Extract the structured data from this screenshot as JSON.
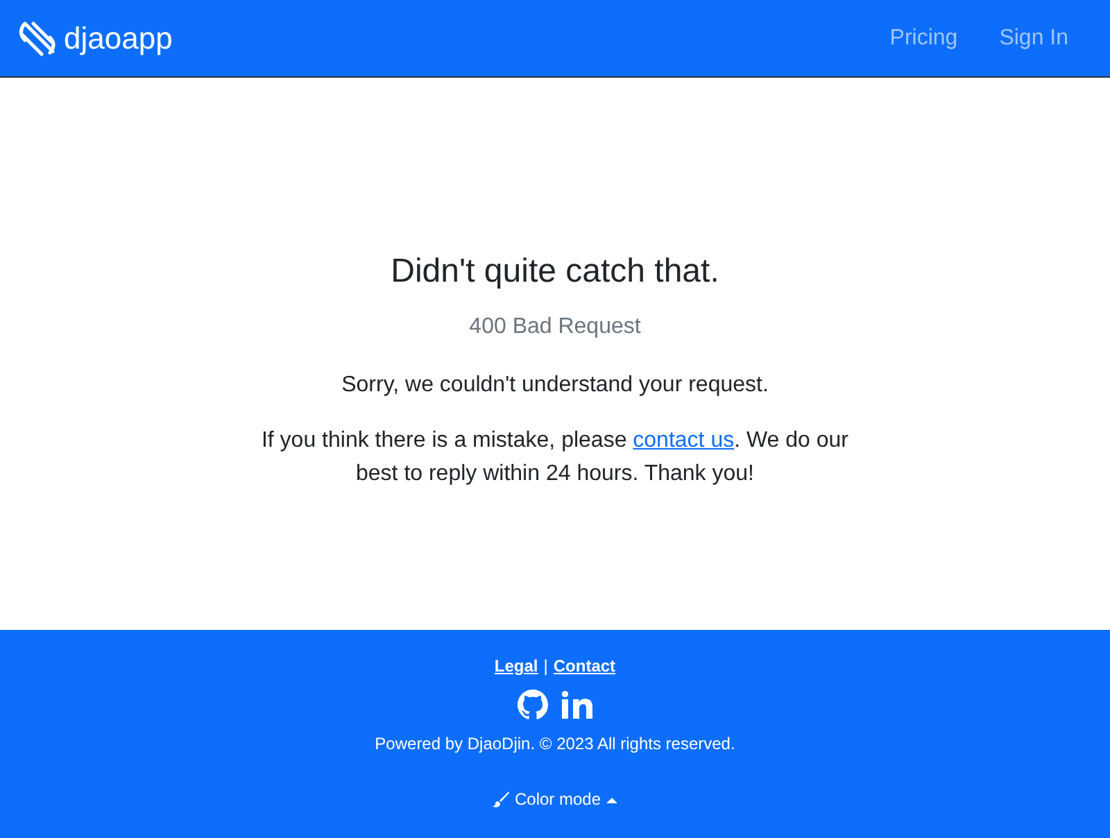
{
  "navbar": {
    "brand": "djaoapp",
    "links": [
      "Pricing",
      "Sign In"
    ]
  },
  "error": {
    "title": "Didn't quite catch that.",
    "status": "400 Bad Request",
    "message": "Sorry, we couldn't understand your request.",
    "help": {
      "before": "If you think there is a mistake, please ",
      "link": "contact us",
      "after": ". We do our best to reply within 24 hours. Thank you!"
    }
  },
  "footer": {
    "links": [
      "Legal",
      "Contact"
    ],
    "separator": "|",
    "copyright": "Powered by DjaoDjin. © 2023 All rights reserved.",
    "color_mode": "Color mode"
  }
}
